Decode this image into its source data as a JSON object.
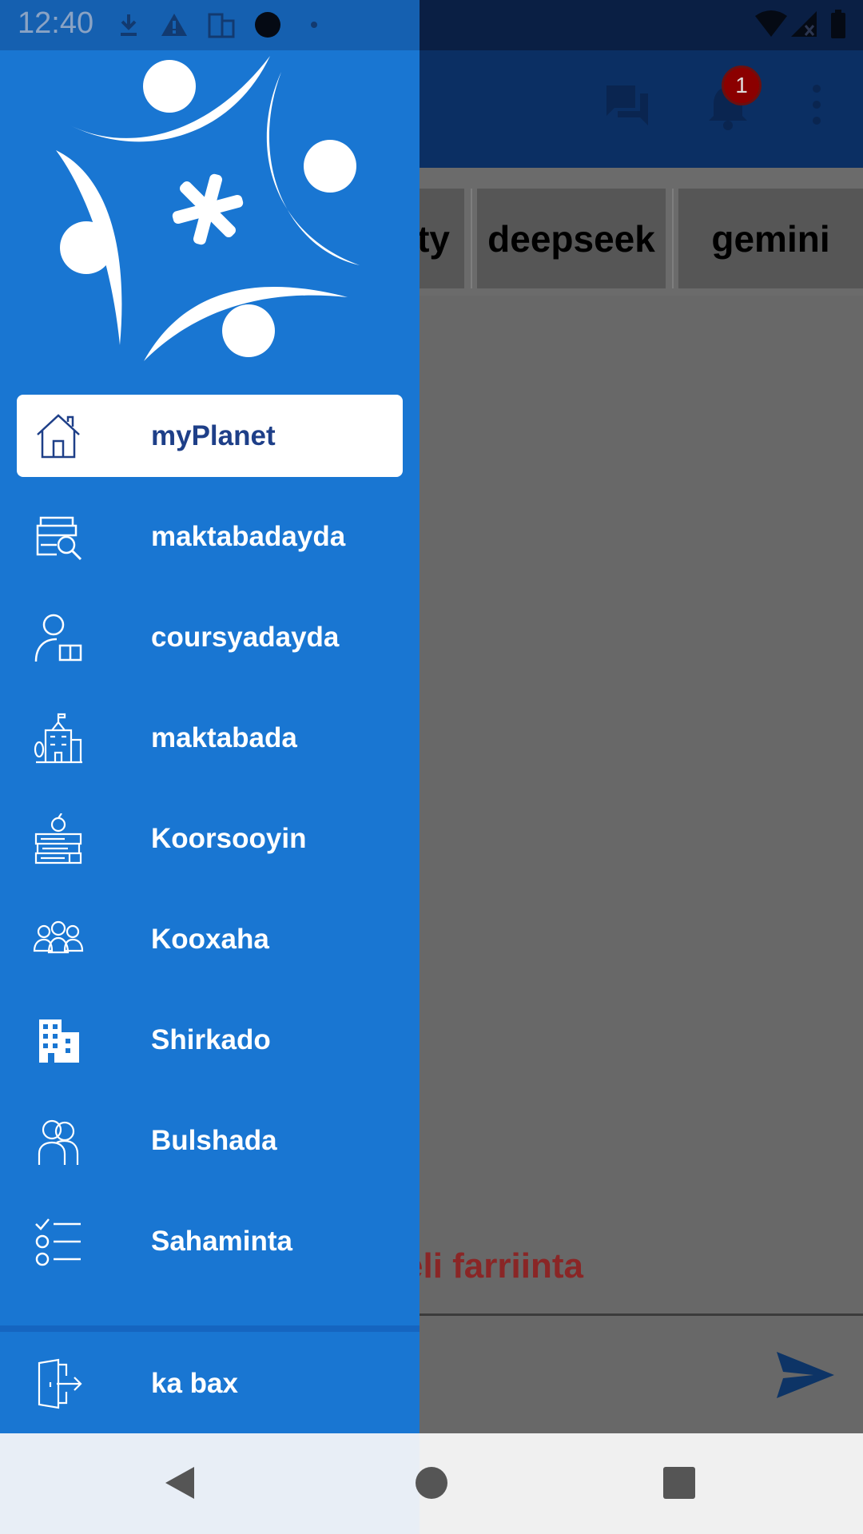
{
  "status_bar": {
    "time": "12:40"
  },
  "toolbar": {
    "notification_count": "1"
  },
  "tabs": {
    "partial_label": "ty",
    "items": [
      "deepseek",
      "gemini"
    ]
  },
  "chat": {
    "hint": "eli farriinta"
  },
  "drawer": {
    "menu": [
      {
        "label": "myPlanet",
        "icon": "home-icon",
        "active": true
      },
      {
        "label": "maktabadayda",
        "icon": "library-search-icon"
      },
      {
        "label": "coursyadayda",
        "icon": "user-book-icon"
      },
      {
        "label": "maktabada",
        "icon": "school-building-icon"
      },
      {
        "label": "Koorsooyin",
        "icon": "books-apple-icon"
      },
      {
        "label": "Kooxaha",
        "icon": "team-icon"
      },
      {
        "label": "Shirkado",
        "icon": "enterprise-building-icon"
      },
      {
        "label": "Bulshada",
        "icon": "community-icon"
      },
      {
        "label": "Sahaminta",
        "icon": "survey-checklist-icon"
      }
    ],
    "logout": {
      "label": "ka bax",
      "icon": "logout-icon"
    }
  },
  "colors": {
    "drawer_bg": "#1976d2",
    "active_label": "#1e3f88",
    "toolbar_bg": "#0b2f63",
    "hint_text": "#8a2626",
    "badge": "#8b0000"
  }
}
